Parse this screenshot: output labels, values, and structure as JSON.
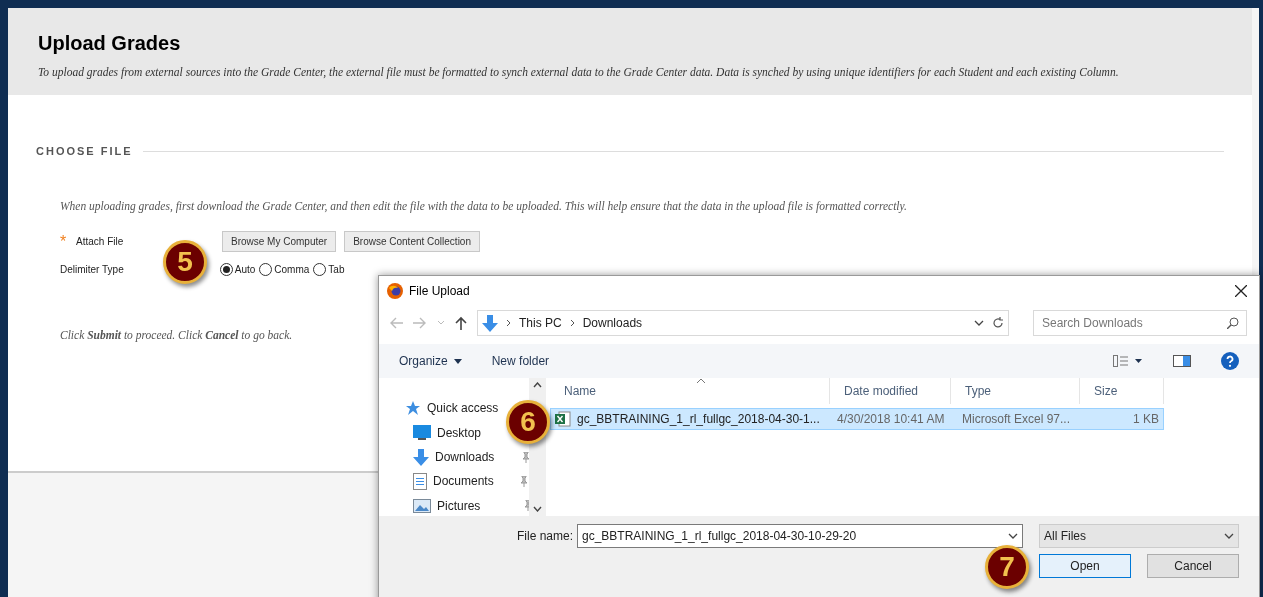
{
  "page": {
    "title": "Upload Grades",
    "description": "To upload grades from external sources into the Grade Center, the external file must be formatted to synch external data to the Grade Center data. Data is synched by using unique identifiers for each Student and each existing Column.",
    "section": "CHOOSE FILE",
    "instructions": "When uploading grades, first download the Grade Center, and then edit the file with the data to be uploaded. This will help ensure that the data in the upload file is formatted correctly.",
    "required_mark": "*",
    "attach_label": "Attach File",
    "attach_buttons": [
      "Browse My Computer",
      "Browse Content Collection"
    ],
    "delimiter_label": "Delimiter Type",
    "delimiter_options": [
      {
        "label": "Auto",
        "selected": true
      },
      {
        "label": "Comma",
        "selected": false
      },
      {
        "label": "Tab",
        "selected": false
      }
    ],
    "footer_note": "Click **Submit** to proceed. Click **Cancel** to go back."
  },
  "steps": [
    "5",
    "6",
    "7"
  ],
  "dialog": {
    "title": "File Upload",
    "path": [
      "This PC",
      "Downloads"
    ],
    "search": {
      "placeholder": "Search Downloads"
    },
    "toolbar": {
      "organize": "Organize",
      "new_folder": "New folder"
    },
    "nav_items": [
      {
        "label": "Quick access",
        "kind": "star",
        "pinned": false
      },
      {
        "label": "Desktop",
        "kind": "desktop",
        "pinned": false
      },
      {
        "label": "Downloads",
        "kind": "download",
        "pinned": true
      },
      {
        "label": "Documents",
        "kind": "document",
        "pinned": true
      },
      {
        "label": "Pictures",
        "kind": "picture",
        "pinned": true
      }
    ],
    "columns": [
      "Name",
      "Date modified",
      "Type",
      "Size"
    ],
    "files": [
      {
        "name": "gc_BBTRAINING_1_rl_fullgc_2018-04-30-1...",
        "date": "4/30/2018 10:41 AM",
        "type": "Microsoft Excel 97...",
        "size": "1 KB",
        "selected": true
      }
    ],
    "file_name_label": "File name:",
    "file_name": "gc_BBTRAINING_1_rl_fullgc_2018-04-30-10-29-20",
    "filter": "All Files",
    "buttons": [
      "Open",
      "Cancel"
    ]
  }
}
